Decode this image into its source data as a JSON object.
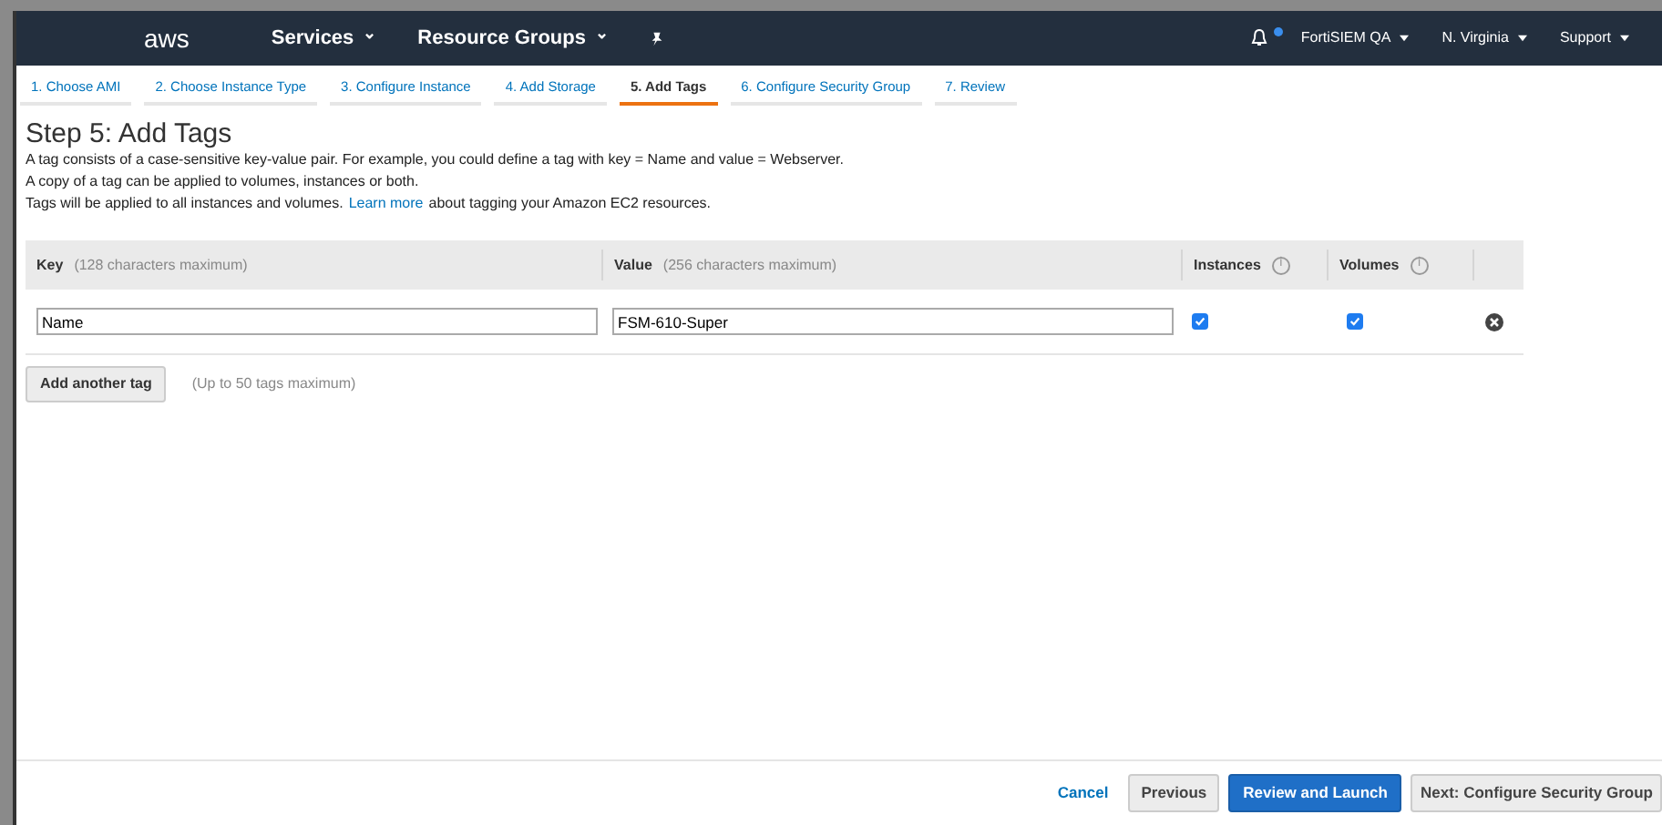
{
  "navbar": {
    "logo": "aws",
    "menus": [
      {
        "label": "Services",
        "caret": "⌄"
      },
      {
        "label": "Resource Groups",
        "caret": "⌄"
      }
    ],
    "right_menus": [
      {
        "label": "FortiSIEM QA"
      },
      {
        "label": "N. Virginia"
      },
      {
        "label": "Support"
      }
    ],
    "notification": true
  },
  "steps": [
    {
      "label": "1. Choose AMI",
      "selected": false
    },
    {
      "label": "2. Choose Instance Type",
      "selected": false
    },
    {
      "label": "3. Configure Instance",
      "selected": false
    },
    {
      "label": "4. Add Storage",
      "selected": false
    },
    {
      "label": "5. Add Tags",
      "selected": true
    },
    {
      "label": "6. Configure Security Group",
      "selected": false
    },
    {
      "label": "7. Review",
      "selected": false
    }
  ],
  "heading": "Step 5: Add Tags",
  "description": [
    "A tag consists of a case-sensitive key-value pair. For example, you could define a tag with key = Name and value = Webserver.",
    "A copy of a tag can be applied to volumes, instances or both."
  ],
  "note": {
    "before": "Tags will be applied to all instances and volumes.",
    "link": "Learn more",
    "after": "about tagging your Amazon EC2 resources."
  },
  "table": {
    "columns": [
      {
        "label": "Key",
        "hint": "(128 characters maximum)"
      },
      {
        "label": "Value",
        "hint": "(256 characters maximum)"
      },
      {
        "label": "Instances",
        "info": "i"
      },
      {
        "label": "Volumes",
        "info": "i"
      }
    ],
    "rows": [
      {
        "key": "Name",
        "value": "FSM-610-Super",
        "instances": true,
        "volumes": true
      }
    ]
  },
  "add_button": "Add another tag",
  "add_hint": "(Up to 50 tags maximum)",
  "footer": {
    "cancel": "Cancel",
    "previous": "Previous",
    "primary": "Review and Launch",
    "next": "Next: Configure Security Group"
  }
}
